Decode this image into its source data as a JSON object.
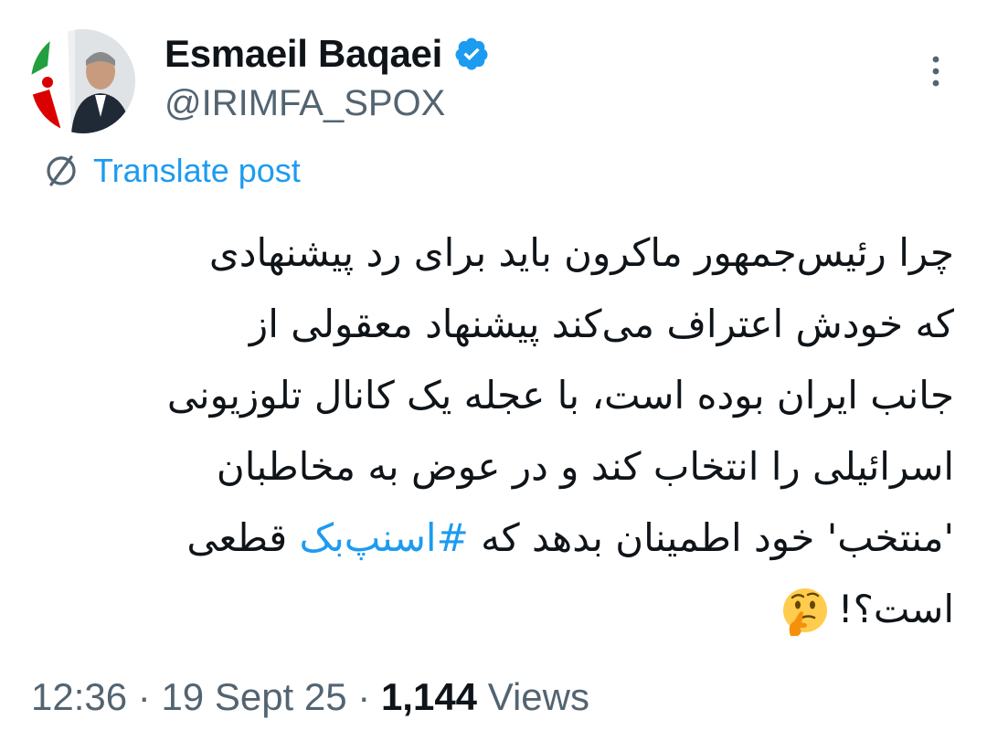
{
  "author": {
    "display_name": "Esmaeil Baqaei",
    "handle": "@IRIMFA_SPOX",
    "verified_color": "#1d9bf0"
  },
  "translate": {
    "label": "Translate post",
    "icon": "translate-globe-icon"
  },
  "post": {
    "lines": [
      "چرا رئیس‌جمهور ماکرون باید برای رد پیشنهادی",
      "که خودش اعتراف می‌کند پیشنهاد معقولی از",
      "جانب ایران بوده است، با عجله یک کانال تلوزیونی",
      "اسرائیلی را انتخاب کند و در عوض به مخاطبان",
      "'منتخب' خود اطمینان بدهد که ",
      "قطعی",
      "است؟!"
    ],
    "hashtag": "#اسنپ‌بک",
    "emoji": "thinking-face-emoji"
  },
  "meta": {
    "time": "12:36",
    "separator": " · ",
    "date": "19 Sept 25",
    "views_count": "1,144",
    "views_label": " Views"
  },
  "colors": {
    "accent": "#1d9bf0",
    "text": "#0f1419",
    "secondary": "#536471"
  }
}
